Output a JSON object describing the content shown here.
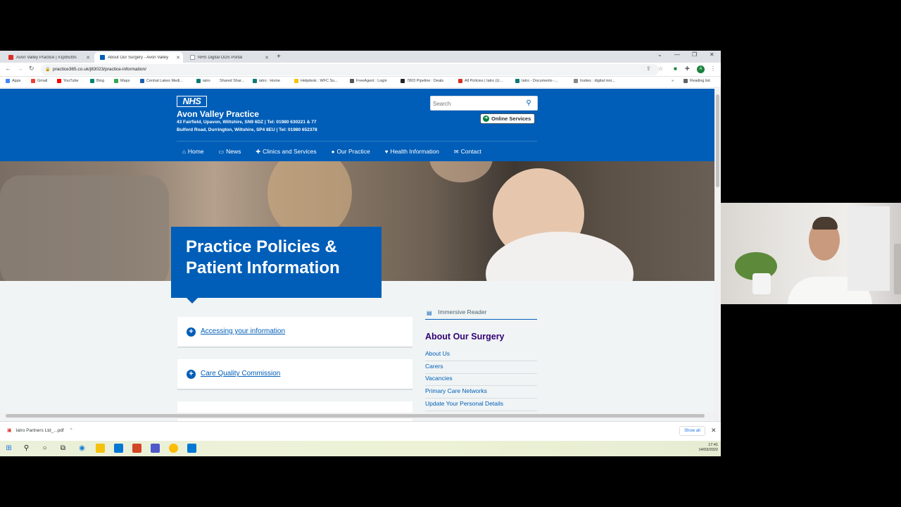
{
  "browser": {
    "tabs": [
      {
        "title": "Avon Valley Practice | #1p8539s",
        "favicon_color": "#d93025"
      },
      {
        "title": "About Our Surgery - Avon Valley",
        "favicon_color": "#005eb8"
      },
      {
        "title": "NHS Digital ODS Portal",
        "favicon_color": "#ffffff"
      }
    ],
    "url": "practice365.co.uk/j83023/practice-information/",
    "profile_initial": "A",
    "bookmarks": [
      {
        "label": "Apps",
        "color": "#4285f4"
      },
      {
        "label": "Gmail",
        "color": "#ea4335"
      },
      {
        "label": "YouTube",
        "color": "#ff0000"
      },
      {
        "label": "Bing",
        "color": "#008373"
      },
      {
        "label": "Maps",
        "color": "#34a853"
      },
      {
        "label": "Central Lakes Medi...",
        "color": "#1a5fb4"
      },
      {
        "label": "iatro",
        "color": "#0b7a75"
      },
      {
        "label": "Shared Shar...",
        "color": "#666666"
      },
      {
        "label": "iatro : Home",
        "color": "#0b7a75"
      },
      {
        "label": "Helpdesk : WFC Su...",
        "color": "#f4c20d"
      },
      {
        "label": "FreeAgent : Login",
        "color": "#555555"
      },
      {
        "label": "7803 Pipeline : Deals",
        "color": "#222222"
      },
      {
        "label": "All Policies | Iatro (U...",
        "color": "#d93025"
      },
      {
        "label": "Iatro - Documents -...",
        "color": "#0b7a75"
      },
      {
        "label": "Insites : digital inni...",
        "color": "#888888"
      }
    ],
    "reading_list": "Reading list"
  },
  "site": {
    "logo": "NHS",
    "practice_name": "Avon Valley Practice",
    "address_line_1": "43 Fairfield, Upavon, Wiltshire, SN9 6DZ | Tel: 01980 630221 & 77",
    "address_line_2": "Bulford Road, Durrington, Wiltshire, SP4 8EU | Tel: 01980 652378",
    "search_placeholder": "Search",
    "online_services": "Online Services",
    "nav": [
      {
        "label": "Home",
        "icon": "home-icon"
      },
      {
        "label": "News",
        "icon": "news-icon"
      },
      {
        "label": "Clinics and Services",
        "icon": "medical-bag-icon"
      },
      {
        "label": "Our Practice",
        "icon": "user-icon"
      },
      {
        "label": "Health Information",
        "icon": "heart-icon"
      },
      {
        "label": "Contact",
        "icon": "envelope-icon"
      }
    ],
    "hero_title": "Practice Policies & Patient Information",
    "accordions": [
      {
        "label": "Accessing your information"
      },
      {
        "label": "Care Quality Commission"
      }
    ],
    "immersive_reader": "Immersive Reader",
    "sidebar": {
      "title": "About Our Surgery",
      "links": [
        "About Us",
        "Carers",
        "Vacancies",
        "Primary Care Networks",
        "Update Your Personal Details"
      ]
    },
    "colors": {
      "nhs_blue": "#005eb8",
      "sidebar_title": "#330072"
    }
  },
  "downloads": {
    "file": "Iatro Partners Ltd_...pdf",
    "show_all": "Show all"
  },
  "taskbar": {
    "time": "17:41",
    "date": "14/03/2022"
  }
}
